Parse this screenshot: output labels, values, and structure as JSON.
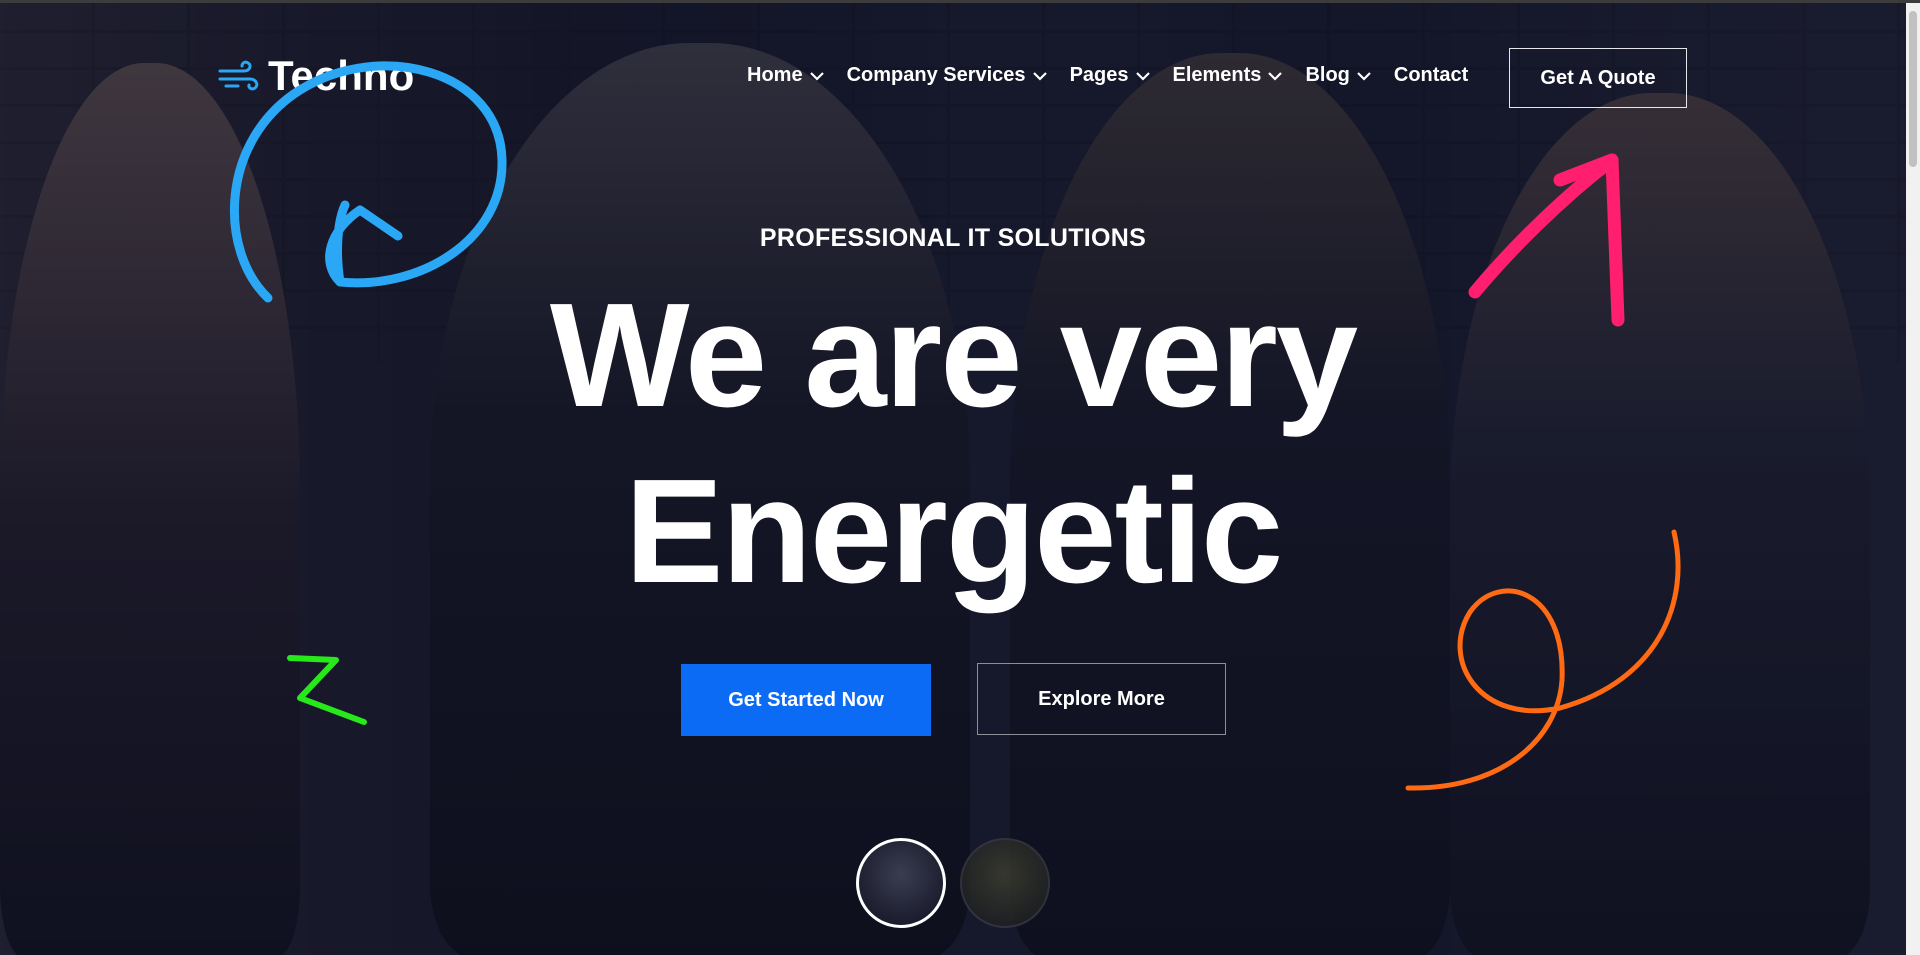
{
  "brand": {
    "name": "Techno",
    "accent": "#0b6bf5"
  },
  "nav": {
    "items": [
      {
        "label": "Home",
        "has_dropdown": true
      },
      {
        "label": "Company Services",
        "has_dropdown": true
      },
      {
        "label": "Pages",
        "has_dropdown": true
      },
      {
        "label": "Elements",
        "has_dropdown": true
      },
      {
        "label": "Blog",
        "has_dropdown": true
      },
      {
        "label": "Contact",
        "has_dropdown": false
      }
    ],
    "cta": "Get A Quote"
  },
  "hero": {
    "subtitle": "PROFESSIONAL IT SOLUTIONS",
    "headline_line1": "We are very",
    "headline_line2": "Energetic",
    "primary_button": "Get Started Now",
    "secondary_button": "Explore More",
    "slides": 2,
    "active_slide": 1
  },
  "annotation_colors": {
    "blue": "#2aa7f5",
    "pink": "#ff1f6e",
    "green": "#27e81a",
    "orange": "#ff6a13"
  }
}
